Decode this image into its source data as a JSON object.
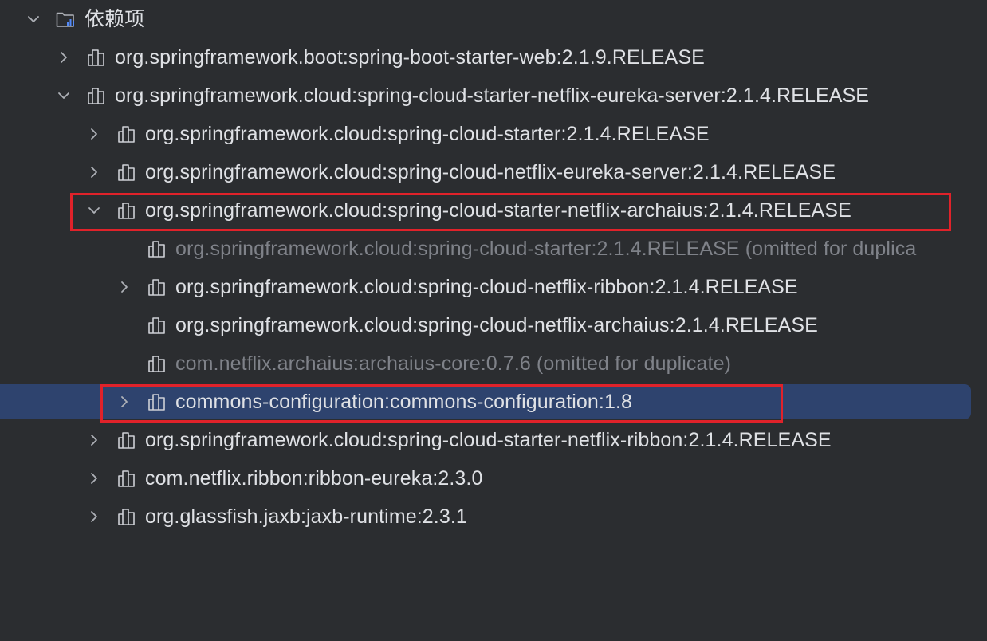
{
  "tree": {
    "root": {
      "label": "依赖项",
      "expanded": true,
      "icon": "folder-chart-icon"
    },
    "rows": [
      {
        "label": "org.springframework.boot:spring-boot-starter-web:2.1.9.RELEASE",
        "expanded": false,
        "icon": "library-icon"
      },
      {
        "label": "org.springframework.cloud:spring-cloud-starter-netflix-eureka-server:2.1.4.RELEASE",
        "expanded": true,
        "icon": "library-icon"
      },
      {
        "label": "org.springframework.cloud:spring-cloud-starter:2.1.4.RELEASE",
        "expanded": false,
        "icon": "library-icon"
      },
      {
        "label": "org.springframework.cloud:spring-cloud-netflix-eureka-server:2.1.4.RELEASE",
        "expanded": false,
        "icon": "library-icon"
      },
      {
        "label": "org.springframework.cloud:spring-cloud-starter-netflix-archaius:2.1.4.RELEASE",
        "expanded": true,
        "icon": "library-icon"
      },
      {
        "label": "org.springframework.cloud:spring-cloud-starter:2.1.4.RELEASE",
        "note": " (omitted for duplica",
        "icon": "library-icon"
      },
      {
        "label": "org.springframework.cloud:spring-cloud-netflix-ribbon:2.1.4.RELEASE",
        "expanded": false,
        "icon": "library-icon"
      },
      {
        "label": "org.springframework.cloud:spring-cloud-netflix-archaius:2.1.4.RELEASE",
        "icon": "library-icon"
      },
      {
        "label": "com.netflix.archaius:archaius-core:0.7.6",
        "note": " (omitted for duplicate)",
        "icon": "library-icon"
      },
      {
        "label": "commons-configuration:commons-configuration:1.8",
        "expanded": false,
        "selected": true,
        "icon": "library-icon"
      },
      {
        "label": "org.springframework.cloud:spring-cloud-starter-netflix-ribbon:2.1.4.RELEASE",
        "expanded": false,
        "icon": "library-icon"
      },
      {
        "label": "com.netflix.ribbon:ribbon-eureka:2.3.0",
        "expanded": false,
        "icon": "library-icon"
      },
      {
        "label": "org.glassfish.jaxb:jaxb-runtime:2.3.1",
        "expanded": false,
        "icon": "library-icon"
      }
    ]
  },
  "colors": {
    "background": "#2b2d30",
    "selection": "#2e436e",
    "text": "#dfe1e5",
    "dim_text": "#7f8289",
    "highlight_box": "#e0222a"
  }
}
